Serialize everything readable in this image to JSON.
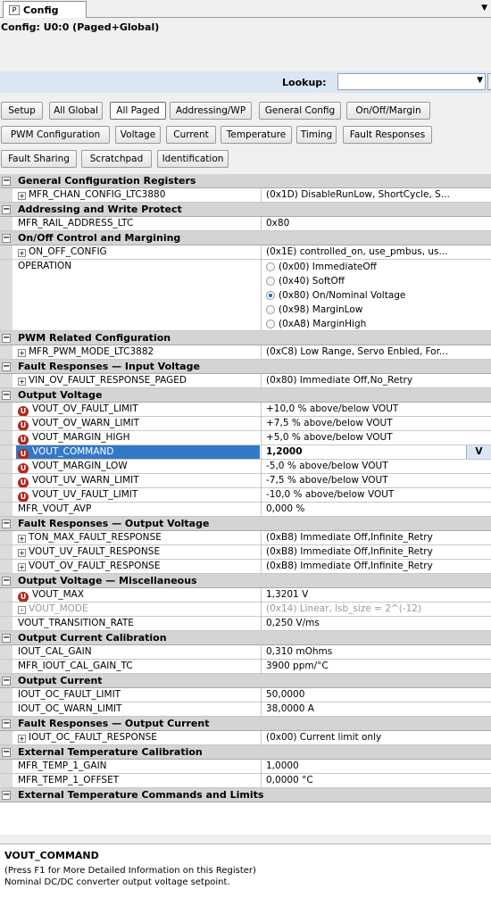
{
  "tab": {
    "icon": "P",
    "label": "Config"
  },
  "subtitle": "Config: U0:0 (Paged+Global)",
  "lookup": {
    "label": "Lookup:",
    "value": ""
  },
  "buttons": [
    [
      "Setup",
      "All Global",
      "All Paged",
      "Addressing/WP",
      "General Config",
      "On/Off/Margin"
    ],
    [
      "PWM Configuration",
      "Voltage",
      "Current",
      "Temperature",
      "Timing",
      "Fault Responses"
    ],
    [
      "Fault Sharing",
      "Scratchpad",
      "Identification"
    ]
  ],
  "active_button": "All Paged",
  "grid": [
    {
      "cat": "General Configuration Registers"
    },
    {
      "name": "MFR_CHAN_CONFIG_LTC3880",
      "val": "(0x1D) DisableRunLow, ShortCycle, S...",
      "icon": "expand"
    },
    {
      "cat": "Addressing and Write Protect"
    },
    {
      "name": "MFR_RAIL_ADDRESS_LTC",
      "val": "0x80"
    },
    {
      "cat": "On/Off Control and Margining"
    },
    {
      "name": "ON_OFF_CONFIG",
      "val": "(0x1E) controlled_on, use_pmbus, us...",
      "icon": "expand"
    },
    {
      "name": "OPERATION",
      "options": [
        {
          "label": "(0x00) ImmediateOff",
          "selected": false
        },
        {
          "label": "(0x40) SoftOff",
          "selected": false
        },
        {
          "label": "(0x80) On/Nominal Voltage",
          "selected": true
        },
        {
          "label": "(0x98) MarginLow",
          "selected": false
        },
        {
          "label": "(0xA8) MarginHigh",
          "selected": false
        }
      ]
    },
    {
      "cat": "PWM Related Configuration"
    },
    {
      "name": "MFR_PWM_MODE_LTC3882",
      "val": "(0xC8) Low Range, Servo Enbled, For...",
      "icon": "expand"
    },
    {
      "cat": "Fault Responses — Input Voltage"
    },
    {
      "name": "VIN_OV_FAULT_RESPONSE_PAGED",
      "val": "(0x80) Immediate Off,No_Retry",
      "icon": "expand"
    },
    {
      "cat": "Output Voltage"
    },
    {
      "name": "VOUT_OV_FAULT_LIMIT",
      "val": "+10,0 % above/below VOUT",
      "icon": "u"
    },
    {
      "name": "VOUT_OV_WARN_LIMIT",
      "val": "+7,5 % above/below VOUT",
      "icon": "u"
    },
    {
      "name": "VOUT_MARGIN_HIGH",
      "val": "+5,0 % above/below VOUT",
      "icon": "u"
    },
    {
      "name": "VOUT_COMMAND",
      "val": "1,2000",
      "icon": "u",
      "selected": true,
      "btn": "V"
    },
    {
      "name": "VOUT_MARGIN_LOW",
      "val": "-5,0 % above/below VOUT",
      "icon": "u"
    },
    {
      "name": "VOUT_UV_WARN_LIMIT",
      "val": "-7,5 % above/below VOUT",
      "icon": "u"
    },
    {
      "name": "VOUT_UV_FAULT_LIMIT",
      "val": "-10,0 % above/below VOUT",
      "icon": "u"
    },
    {
      "name": "MFR_VOUT_AVP",
      "val": "0,000 %"
    },
    {
      "cat": "Fault Responses — Output Voltage"
    },
    {
      "name": "TON_MAX_FAULT_RESPONSE",
      "val": "(0xB8) Immediate Off,Infinite_Retry",
      "icon": "expand"
    },
    {
      "name": "VOUT_UV_FAULT_RESPONSE",
      "val": "(0xB8) Immediate Off,Infinite_Retry",
      "icon": "expand"
    },
    {
      "name": "VOUT_OV_FAULT_RESPONSE",
      "val": "(0xB8) Immediate Off,Infinite_Retry",
      "icon": "expand"
    },
    {
      "cat": "Output Voltage — Miscellaneous"
    },
    {
      "name": "VOUT_MAX",
      "val": "1,3201 V",
      "icon": "u"
    },
    {
      "name": "VOUT_MODE",
      "val": "(0x14) Linear, lsb_size = 2^(-12)",
      "icon": "expand",
      "dim": true
    },
    {
      "name": "VOUT_TRANSITION_RATE",
      "val": "0,250 V/ms"
    },
    {
      "cat": "Output Current Calibration"
    },
    {
      "name": "IOUT_CAL_GAIN",
      "val": "0,310 mOhms"
    },
    {
      "name": "MFR_IOUT_CAL_GAIN_TC",
      "val": "3900 ppm/°C"
    },
    {
      "cat": "Output Current"
    },
    {
      "name": "IOUT_OC_FAULT_LIMIT",
      "val": "50,0000"
    },
    {
      "name": "IOUT_OC_WARN_LIMIT",
      "val": "38,0000 A"
    },
    {
      "cat": "Fault Responses — Output Current"
    },
    {
      "name": "IOUT_OC_FAULT_RESPONSE",
      "val": "(0x00) Current limit only",
      "icon": "expand"
    },
    {
      "cat": "External Temperature Calibration"
    },
    {
      "name": "MFR_TEMP_1_GAIN",
      "val": "1,0000"
    },
    {
      "name": "MFR_TEMP_1_OFFSET",
      "val": "0,0000 °C"
    },
    {
      "cat": "External Temperature Commands and Limits"
    }
  ],
  "footer": {
    "title": "VOUT_COMMAND",
    "line1": "(Press F1 for More Detailed Information on this Register)",
    "line2": "Nominal DC/DC converter output voltage setpoint."
  }
}
